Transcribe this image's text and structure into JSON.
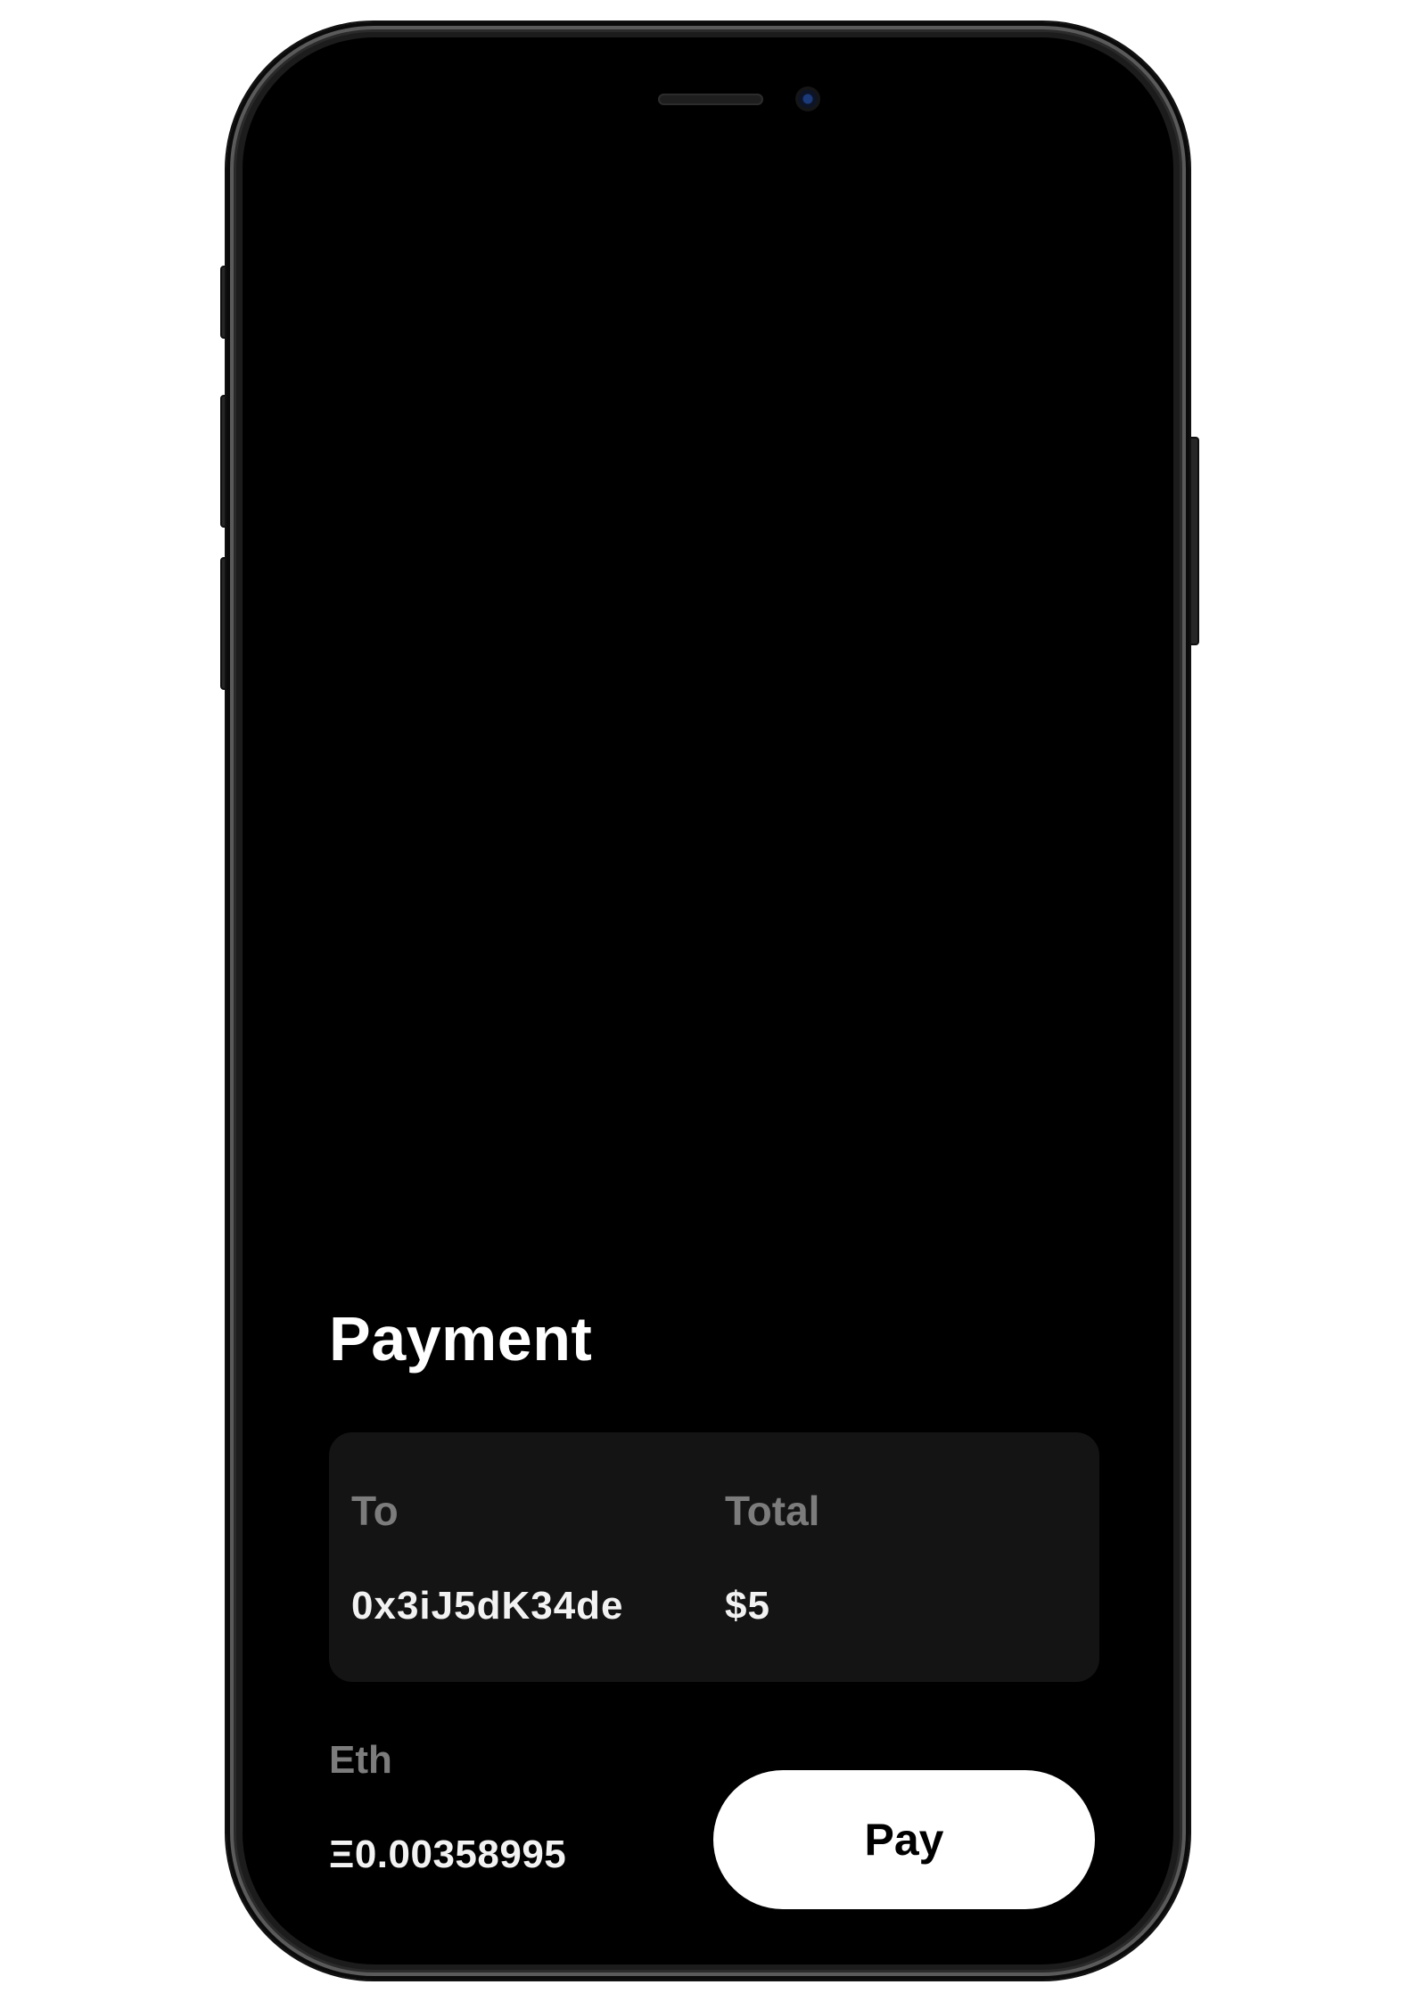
{
  "payment": {
    "title": "Payment",
    "to_label": "To",
    "to_value": "0x3iJ5dK34de",
    "total_label": "Total",
    "total_value": "$5",
    "eth_label": "Eth",
    "eth_amount": "Ξ0.00358995",
    "pay_label": "Pay"
  },
  "colors": {
    "screen_background": "#000000",
    "card_background": "#141414",
    "label_text": "#7c7c7c",
    "value_text": "#f2f2f2",
    "button_background": "#ffffff",
    "button_text": "#000000"
  }
}
